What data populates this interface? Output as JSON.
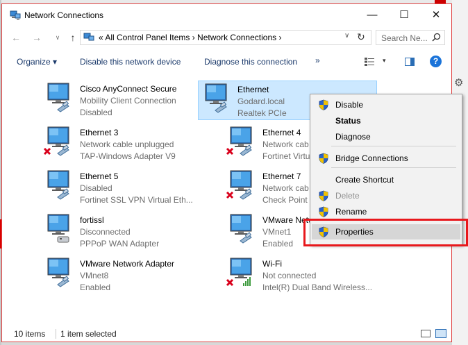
{
  "window": {
    "title": "Network Connections"
  },
  "nav": {
    "address_parts": "«  All Control Panel Items  ›  Network Connections  ›",
    "search_placeholder": "Search Ne..."
  },
  "toolbar": {
    "organize": "Organize ▾",
    "disable": "Disable this network device",
    "diagnose": "Diagnose this connection",
    "more": "»"
  },
  "items": [
    {
      "name": "Cisco AnyConnect Secure",
      "line2": "Mobility Client Connection",
      "line3": "Disabled",
      "status_icon": "none"
    },
    {
      "name": "Ethernet",
      "line2": "Godard.local",
      "line3": "Realtek PCIe",
      "status_icon": "none",
      "selected": true
    },
    {
      "name": "Ethernet 3",
      "line2": "Network cable unplugged",
      "line3": "TAP-Windows Adapter V9",
      "status_icon": "red-x"
    },
    {
      "name": "Ethernet 4",
      "line2": "Network cab",
      "line3": "Fortinet Virtu",
      "status_icon": "red-x"
    },
    {
      "name": "Ethernet 5",
      "line2": "Disabled",
      "line3": "Fortinet SSL VPN Virtual Eth...",
      "status_icon": "none"
    },
    {
      "name": "Ethernet 7",
      "line2": "Network cab",
      "line3": "Check Point V",
      "status_icon": "red-x"
    },
    {
      "name": "fortissl",
      "line2": "Disconnected",
      "line3": "PPPoP WAN Adapter",
      "status_icon": "modem"
    },
    {
      "name": "VMware Netw",
      "line2": "VMnet1",
      "line3": "Enabled",
      "status_icon": "none"
    },
    {
      "name": "VMware Network Adapter",
      "line2": "VMnet8",
      "line3": "Enabled",
      "status_icon": "none"
    },
    {
      "name": "Wi-Fi",
      "line2": "Not connected",
      "line3": "Intel(R) Dual Band Wireless...",
      "status_icon": "red-x-wifi"
    }
  ],
  "context_menu": {
    "items": [
      {
        "label": "Disable",
        "shield": true,
        "style": "normal"
      },
      {
        "label": "Status",
        "shield": false,
        "style": "bold"
      },
      {
        "label": "Diagnose",
        "shield": false,
        "style": "normal"
      },
      {
        "label": "Bridge Connections",
        "shield": true,
        "style": "normal"
      },
      {
        "label": "Create Shortcut",
        "shield": false,
        "style": "normal"
      },
      {
        "label": "Delete",
        "shield": true,
        "style": "disabled"
      },
      {
        "label": "Rename",
        "shield": true,
        "style": "normal"
      },
      {
        "label": "Properties",
        "shield": true,
        "style": "normal",
        "hover": true
      }
    ]
  },
  "status": {
    "count": "10 items",
    "selection": "1 item selected"
  },
  "colors": {
    "accent": "#1a73d9",
    "selection": "#cce8ff",
    "annotation": "#e8181c"
  }
}
